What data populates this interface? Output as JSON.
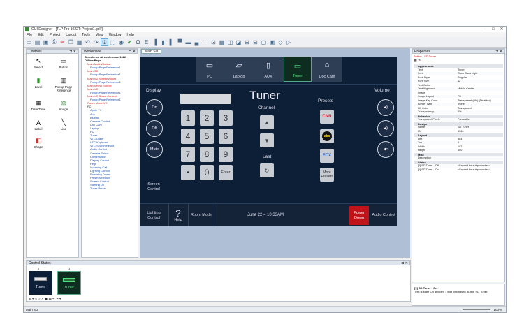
{
  "window": {
    "title": "GUI Designer - [TLP Pro 1022T: Project1.gdl*]",
    "controls": [
      "–",
      "□",
      "✕"
    ]
  },
  "menu": [
    "File",
    "Edit",
    "Project",
    "Layout",
    "Tools",
    "View",
    "Window",
    "Help"
  ],
  "toolbar_icons": [
    "new",
    "open",
    "save",
    "print",
    "cut",
    "copy",
    "paste",
    "undo",
    "redo",
    "image",
    "select",
    "pointer",
    "check",
    "omega",
    "text",
    "align-left",
    "align-center",
    "align-right",
    "align-top",
    "align-middle",
    "align-bottom",
    "distribute",
    "size",
    "grid"
  ],
  "controls_panel": {
    "title": "Controls",
    "tools": [
      "Select",
      "Button",
      "Level",
      "Popup Page Reference",
      "Date/Time",
      "Image",
      "Label",
      "Line",
      "Shape"
    ]
  },
  "workspace_panel": {
    "title": "Workspace",
    "tree": [
      {
        "t": "Turbulence Airconference 1022",
        "c": "bold"
      },
      {
        "t": "Offline Page",
        "c": "bold"
      },
      {
        "t": "Main Multi Window",
        "c": "red"
      },
      {
        "t": "Popup Page Reference1",
        "c": "blue"
      },
      {
        "t": "Main SD",
        "c": "red"
      },
      {
        "t": "Popup Page Reference1",
        "c": "blue"
      },
      {
        "t": "Main SD Screen Adjust",
        "c": "red"
      },
      {
        "t": "Popup Page Reference1",
        "c": "blue"
      },
      {
        "t": "Main Select Source",
        "c": "red"
      },
      {
        "t": "Main VC",
        "c": "red"
      },
      {
        "t": "Popup Page Reference1",
        "c": "blue"
      },
      {
        "t": "Main VC Share Content",
        "c": "red"
      },
      {
        "t": "Popup Page Reference1",
        "c": "blue"
      },
      {
        "t": "Room Mode VC",
        "c": "red"
      },
      {
        "t": "PC",
        "c": "blk"
      },
      {
        "t": "Apple TV",
        "c": "blue"
      },
      {
        "t": "Aux",
        "c": "blue"
      },
      {
        "t": "BluRay",
        "c": "blue"
      },
      {
        "t": "Camera Control",
        "c": "blue"
      },
      {
        "t": "Doc Cam",
        "c": "blue"
      },
      {
        "t": "Laptop",
        "c": "blue"
      },
      {
        "t": "PC",
        "c": "blue"
      },
      {
        "t": "Tuner",
        "c": "blue"
      },
      {
        "t": "VTC Dialer",
        "c": "blue"
      },
      {
        "t": "VTC Keyboard",
        "c": "blue"
      },
      {
        "t": "VTC Search Result",
        "c": "blue"
      },
      {
        "t": "Audio Control",
        "c": "blue"
      },
      {
        "t": "Camera Select",
        "c": "blue"
      },
      {
        "t": "Confirmation",
        "c": "blue"
      },
      {
        "t": "Display Control",
        "c": "blue"
      },
      {
        "t": "Help",
        "c": "blue"
      },
      {
        "t": "Incoming Call",
        "c": "blue"
      },
      {
        "t": "Lighting Control",
        "c": "blue"
      },
      {
        "t": "Powering Down",
        "c": "blue"
      },
      {
        "t": "Preset Selection",
        "c": "blue"
      },
      {
        "t": "Screen Control",
        "c": "blue"
      },
      {
        "t": "Starting Up",
        "c": "blue"
      },
      {
        "t": "Tuner Preset",
        "c": "blue"
      }
    ]
  },
  "document": {
    "tab": "Main SD"
  },
  "touch": {
    "sources": [
      {
        "label": "PC",
        "glyph": "🖥"
      },
      {
        "label": "Laptop",
        "glyph": "💻"
      },
      {
        "label": "AUX",
        "glyph": "🎵"
      },
      {
        "label": "Tuner",
        "glyph": "▭"
      },
      {
        "label": "Doc Cam",
        "glyph": "⌂"
      }
    ],
    "display_label": "Display",
    "display_buttons": [
      "On",
      "Off",
      "Mute"
    ],
    "title": "Tuner",
    "keypad": [
      "1",
      "2",
      "3",
      "4",
      "5",
      "6",
      "7",
      "8",
      "9",
      "●",
      "0",
      "Enter"
    ],
    "channel_label": "Channel",
    "last_label": "Last",
    "presets_label": "Presets",
    "presets": [
      "CNN",
      "abc",
      "FOX"
    ],
    "more_presets": "More Presets",
    "volume_label": "Volume",
    "bottom": {
      "screen": "Screen Control",
      "lighting": "Lighting Control",
      "help": "Help",
      "room": "Room Mode",
      "datetime": "June 22 – 10:33AM",
      "power": "Power Down",
      "audio": "Audio Control"
    }
  },
  "properties": {
    "title": "Properties",
    "selected": "Button - SD Tuner",
    "rows": [
      {
        "cat": "Appearance"
      },
      {
        "k": "Text",
        "v": "Tuner"
      },
      {
        "k": "Font",
        "v": "Open Sans Light"
      },
      {
        "k": "Font Style",
        "v": "Regular"
      },
      {
        "k": "Font Size",
        "v": "12"
      },
      {
        "k": "Text Color",
        "v": ""
      },
      {
        "k": "Text Alignment",
        "v": "Middle Center"
      },
      {
        "k": "Image",
        "v": ""
      },
      {
        "k": "Image Layout",
        "v": "Fill"
      },
      {
        "k": "Image Key Color",
        "v": "Transparent (0%) (Disabled)"
      },
      {
        "k": "Border Type",
        "v": "(none)"
      },
      {
        "k": "Fill Color",
        "v": "Transparent"
      },
      {
        "k": "Transparency",
        "v": "0%"
      },
      {
        "cat": "Behavior"
      },
      {
        "k": "Transparent Pixels",
        "v": "Pressable"
      },
      {
        "cat": "Design"
      },
      {
        "k": "Name",
        "v": "SD Tuner"
      },
      {
        "k": "ID",
        "v": "8060"
      },
      {
        "cat": "Layout"
      },
      {
        "k": "Left",
        "v": "564"
      },
      {
        "k": "Top",
        "v": "0"
      },
      {
        "k": "Width",
        "v": "102"
      },
      {
        "k": "Height",
        "v": "100"
      },
      {
        "cat": "Misc"
      },
      {
        "k": "Description",
        "v": ""
      },
      {
        "cat": "States"
      },
      {
        "k": "[0] SD Tuner - Off",
        "v": "<Expand for subproperties>"
      },
      {
        "k": "[1] SD Tuner - On",
        "v": "<Expand for subproperties>"
      }
    ],
    "desc_title": "[1] SD Tuner - On",
    "desc_text": "This is state On at index 1 that belongs to Button SD Tuner."
  },
  "states_panel": {
    "title": "Control States",
    "indices": [
      "0",
      "1"
    ],
    "labels": [
      "Tuner",
      "Tuner"
    ]
  },
  "status": {
    "left": "Main SD",
    "zoom": "100%"
  },
  "colors": {
    "accent": "#4ee07a",
    "panel": "#0d1f36",
    "power": "#c0141a"
  }
}
